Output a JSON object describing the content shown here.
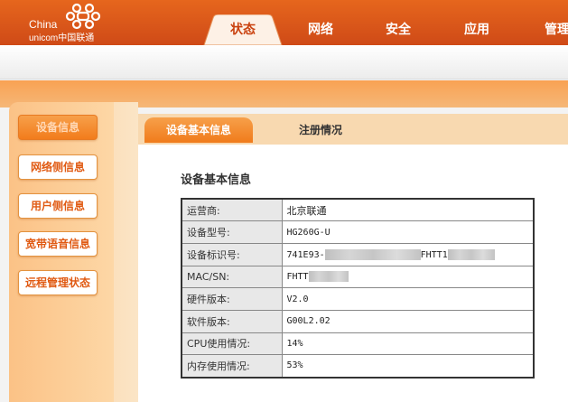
{
  "brand": {
    "line1": "China",
    "line2": "unicom中国联通"
  },
  "nav": {
    "tabs": [
      {
        "label": "状态",
        "active": true
      },
      {
        "label": "网络",
        "active": false
      },
      {
        "label": "安全",
        "active": false
      },
      {
        "label": "应用",
        "active": false
      },
      {
        "label": "管理",
        "active": false
      }
    ]
  },
  "sidebar": {
    "items": [
      {
        "label": "设备信息",
        "active": true
      },
      {
        "label": "网络侧信息",
        "active": false
      },
      {
        "label": "用户侧信息",
        "active": false
      },
      {
        "label": "宽带语音信息",
        "active": false
      },
      {
        "label": "远程管理状态",
        "active": false
      }
    ]
  },
  "content": {
    "tabs": [
      {
        "label": "设备基本信息",
        "active": true
      },
      {
        "label": "注册情况",
        "active": false
      }
    ],
    "section_title": "设备基本信息",
    "rows": [
      {
        "key": "运营商:",
        "value": "北京联通"
      },
      {
        "key": "设备型号:",
        "value": "HG260G-U"
      },
      {
        "key": "设备标识号:",
        "value_prefix": "741E93-",
        "value_mid": "FHTT1"
      },
      {
        "key": "MAC/SN:",
        "value_prefix": "FHTT"
      },
      {
        "key": "硬件版本:",
        "value": "V2.0"
      },
      {
        "key": "软件版本:",
        "value": "G00L2.02"
      },
      {
        "key": "CPU使用情况:",
        "value": "14%"
      },
      {
        "key": "内存使用情况:",
        "value": "53%"
      }
    ]
  },
  "colors": {
    "brand_orange": "#d9541c",
    "accent_orange": "#f27c1c",
    "sidebar_bg": "#fbc286"
  }
}
